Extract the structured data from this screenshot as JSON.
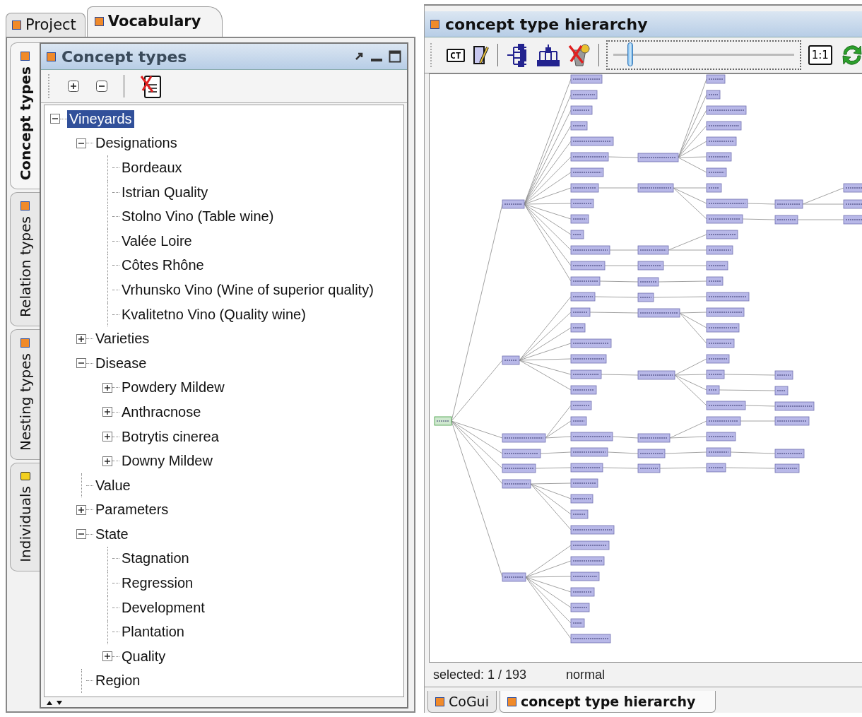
{
  "top_tabs": [
    {
      "label": "Project",
      "selected": false
    },
    {
      "label": "Vocabulary",
      "selected": true
    }
  ],
  "side_tabs": [
    {
      "label": "Concept types",
      "selected": true,
      "kind": "type"
    },
    {
      "label": "Relation types",
      "selected": false,
      "kind": "type"
    },
    {
      "label": "Nesting types",
      "selected": false,
      "kind": "type"
    },
    {
      "label": "Individuals",
      "selected": false,
      "kind": "individual"
    }
  ],
  "view": {
    "title": "Concept types"
  },
  "tree": [
    {
      "label": "Vineyards",
      "selected": true,
      "expanded": true,
      "children": [
        {
          "label": "Designations",
          "selected": false,
          "expanded": true,
          "children": [
            {
              "label": "Bordeaux",
              "selected": false
            },
            {
              "label": "Istrian Quality",
              "selected": false
            },
            {
              "label": "Stolno Vino (Table wine)",
              "selected": false
            },
            {
              "label": "Valée Loire",
              "selected": false
            },
            {
              "label": "Côtes Rhône",
              "selected": false
            },
            {
              "label": "Vrhunsko Vino (Wine of superior quality)",
              "selected": false
            },
            {
              "label": "Kvalitetno Vino (Quality wine)",
              "selected": false
            }
          ]
        },
        {
          "label": "Varieties",
          "selected": false,
          "expanded": false
        },
        {
          "label": "Disease",
          "selected": false,
          "expanded": true,
          "children": [
            {
              "label": "Powdery Mildew",
              "selected": false,
              "expanded": false
            },
            {
              "label": "Anthracnose",
              "selected": false,
              "expanded": false
            },
            {
              "label": "Botrytis cinerea",
              "selected": false,
              "expanded": false
            },
            {
              "label": "Downy Mildew",
              "selected": false,
              "expanded": false
            }
          ]
        },
        {
          "label": "Value",
          "selected": false
        },
        {
          "label": "Parameters",
          "selected": false,
          "expanded": false
        },
        {
          "label": "State",
          "selected": false,
          "expanded": true,
          "children": [
            {
              "label": "Stagnation",
              "selected": false
            },
            {
              "label": "Regression",
              "selected": false
            },
            {
              "label": "Development",
              "selected": false
            },
            {
              "label": "Plantation",
              "selected": false
            },
            {
              "label": "Quality",
              "selected": false,
              "expanded": false
            }
          ]
        },
        {
          "label": "Region",
          "selected": false
        }
      ]
    }
  ],
  "hierarchy": {
    "title": "concept type hierarchy",
    "ct_button": "CT",
    "zoom": {
      "level": 0.09
    },
    "fit_button": "1:1",
    "status": {
      "selected": "selected: 1 / 193",
      "mode": "normal"
    }
  },
  "bottom_tabs": [
    {
      "label": "CoGui",
      "selected": false
    },
    {
      "label": "concept type hierarchy",
      "selected": true
    }
  ]
}
